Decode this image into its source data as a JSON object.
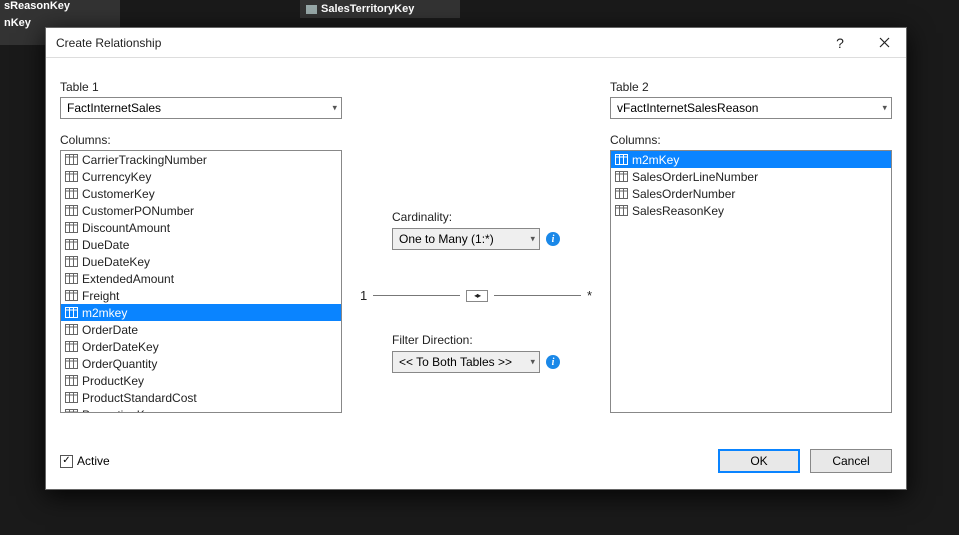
{
  "background": {
    "left_top_label": "sReasonKey",
    "left_mid_label": "nKey",
    "right_label": "SalesTerritoryKey"
  },
  "dialog": {
    "title": "Create Relationship"
  },
  "table1": {
    "label": "Table 1",
    "value": "FactInternetSales",
    "columns_label": "Columns:",
    "items": [
      "CarrierTrackingNumber",
      "CurrencyKey",
      "CustomerKey",
      "CustomerPONumber",
      "DiscountAmount",
      "DueDate",
      "DueDateKey",
      "ExtendedAmount",
      "Freight",
      "m2mkey",
      "OrderDate",
      "OrderDateKey",
      "OrderQuantity",
      "ProductKey",
      "ProductStandardCost",
      "PromotionKey"
    ],
    "selected_index": 9
  },
  "table2": {
    "label": "Table 2",
    "value": "vFactInternetSalesReason",
    "columns_label": "Columns:",
    "items": [
      "m2mKey",
      "SalesOrderLineNumber",
      "SalesOrderNumber",
      "SalesReasonKey"
    ],
    "selected_index": 0
  },
  "cardinality": {
    "label": "Cardinality:",
    "value": "One to Many (1:*)"
  },
  "link": {
    "left": "1",
    "right": "*"
  },
  "filter_direction": {
    "label": "Filter Direction:",
    "value": "<< To Both Tables >>"
  },
  "active": {
    "label": "Active",
    "checked": true
  },
  "buttons": {
    "ok": "OK",
    "cancel": "Cancel"
  }
}
